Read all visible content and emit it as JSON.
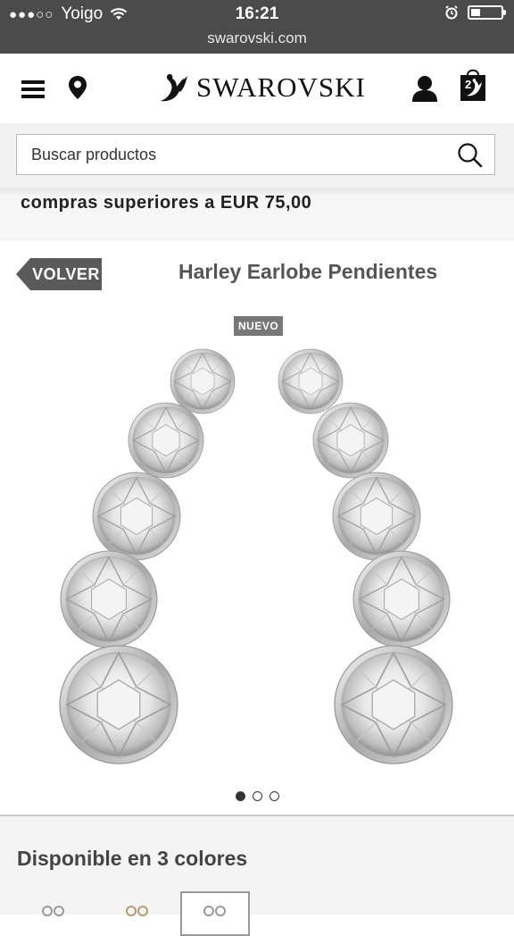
{
  "status_bar": {
    "carrier": "Yoigo",
    "signal_dots": "●●●○○",
    "time": "16:21",
    "url": "swarovski.com",
    "battery_level": 0.3
  },
  "header": {
    "brand": "SWAROVSKI",
    "bag_count": "2"
  },
  "search": {
    "placeholder": "Buscar productos"
  },
  "promo": {
    "text": "compras superiores a EUR 75,00"
  },
  "page": {
    "back_label": "VOLVER",
    "title": "Harley Earlobe Pendientes"
  },
  "product": {
    "badge": "NUEVO",
    "image_count": 3,
    "active_image": 1
  },
  "colors_section": {
    "title": "Disponible en 3 colores",
    "options_count": 3,
    "selected_index": 2
  },
  "theme": {
    "status_bg": "#4b4b4b",
    "back_bg": "#5a5a5a",
    "badge_bg": "#777777"
  }
}
